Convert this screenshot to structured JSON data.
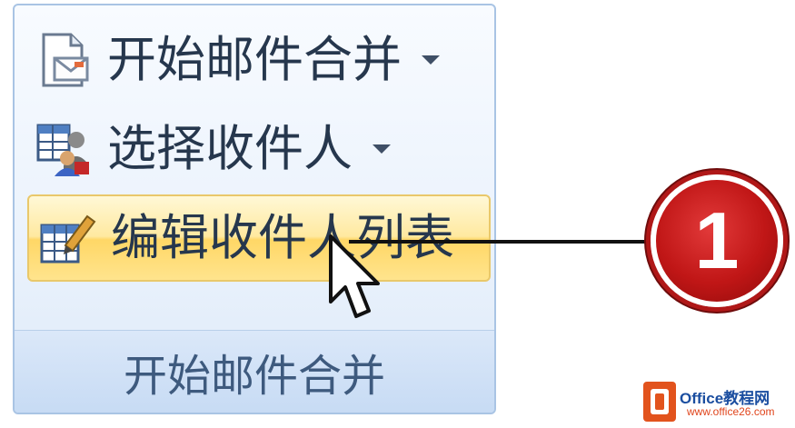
{
  "ribbon": {
    "commands": [
      {
        "label": "开始邮件合并",
        "icon": "mail-merge-document-icon",
        "has_dropdown": true
      },
      {
        "label": "选择收件人",
        "icon": "select-recipients-icon",
        "has_dropdown": true
      },
      {
        "label": "编辑收件人列表",
        "icon": "edit-recipient-list-icon",
        "highlighted": true
      }
    ],
    "group_label": "开始邮件合并"
  },
  "callout": {
    "number": "1"
  },
  "watermark": {
    "brand": "Office教程网",
    "url": "www.office26.com"
  },
  "colors": {
    "highlight": "#ffd766",
    "callout": "#c01616",
    "group_border": "#a9c4e4"
  }
}
